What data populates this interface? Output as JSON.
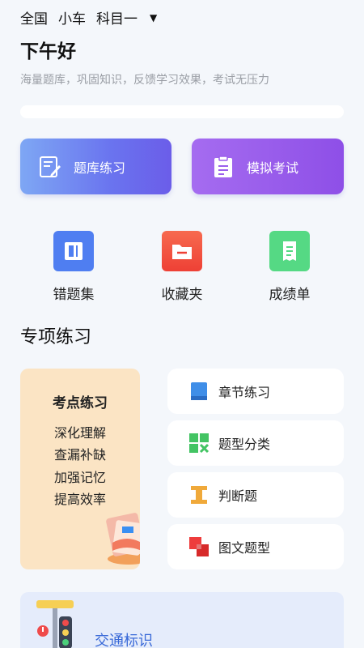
{
  "topbar": {
    "region": "全国",
    "vehicle": "小车",
    "subject": "科目一"
  },
  "greeting": "下午好",
  "subtitle": "海量题库，巩固知识，反馈学习效果，考试无压力",
  "actions": {
    "bank_label": "题库练习",
    "exam_label": "模拟考试"
  },
  "quick": [
    {
      "label": "错题集"
    },
    {
      "label": "收藏夹"
    },
    {
      "label": "成绩单"
    }
  ],
  "section_title": "专项练习",
  "kaodian": {
    "title": "考点练习",
    "lines": [
      "深化理解",
      "查漏补缺",
      "加强记忆",
      "提高效率"
    ]
  },
  "special_items": [
    {
      "label": "章节练习"
    },
    {
      "label": "题型分类"
    },
    {
      "label": "判断题"
    },
    {
      "label": "图文题型"
    }
  ],
  "traffic": {
    "label": "交通标识"
  },
  "colors": {
    "accent_blue": "#4f7ef1",
    "accent_purple": "#8e4fe7",
    "card_orange": "#fbe4c4"
  }
}
